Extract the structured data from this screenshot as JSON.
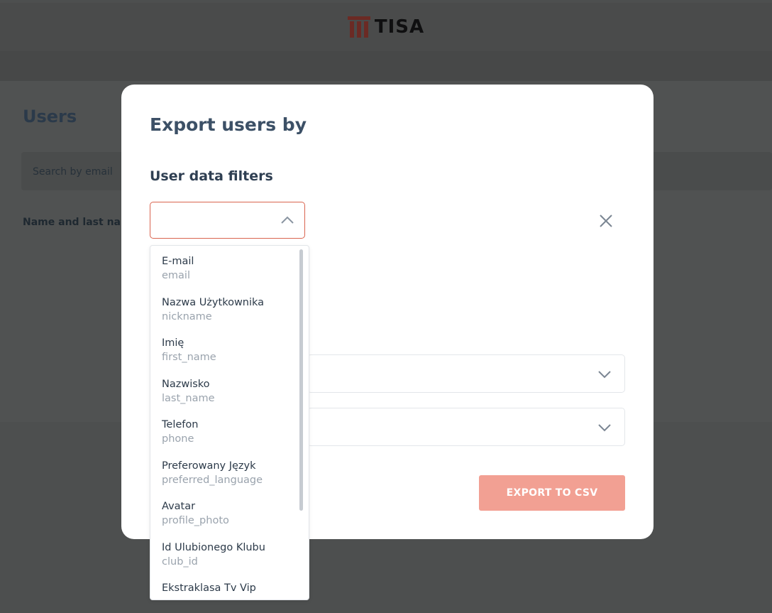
{
  "header": {
    "brand": "TISA"
  },
  "background": {
    "title": "Users",
    "search_placeholder": "Search by email",
    "column_header": "Name and last na"
  },
  "modal": {
    "title": "Export users by",
    "filters_title": "User data filters",
    "export_label": "EXPORT TO CSV"
  },
  "dropdown": {
    "options": [
      {
        "label": "E-mail",
        "key": "email"
      },
      {
        "label": "Nazwa Użytkownika",
        "key": "nickname"
      },
      {
        "label": "Imię",
        "key": "first_name"
      },
      {
        "label": "Nazwisko",
        "key": "last_name"
      },
      {
        "label": "Telefon",
        "key": "phone"
      },
      {
        "label": "Preferowany Język",
        "key": "preferred_language"
      },
      {
        "label": "Avatar",
        "key": "profile_photo"
      },
      {
        "label": "Id Ulubionego Klubu",
        "key": "club_id"
      },
      {
        "label": "Ekstraklasa Tv Vip",
        "key": ""
      }
    ]
  },
  "colors": {
    "accent": "#d9644f",
    "export_button": "#f2a093",
    "brand_red": "#c0392b"
  },
  "icons": {
    "logo": "tisa-logo-icon",
    "chevron_up": "chevron-up-icon",
    "chevron_down": "chevron-down-icon",
    "close": "close-icon"
  }
}
